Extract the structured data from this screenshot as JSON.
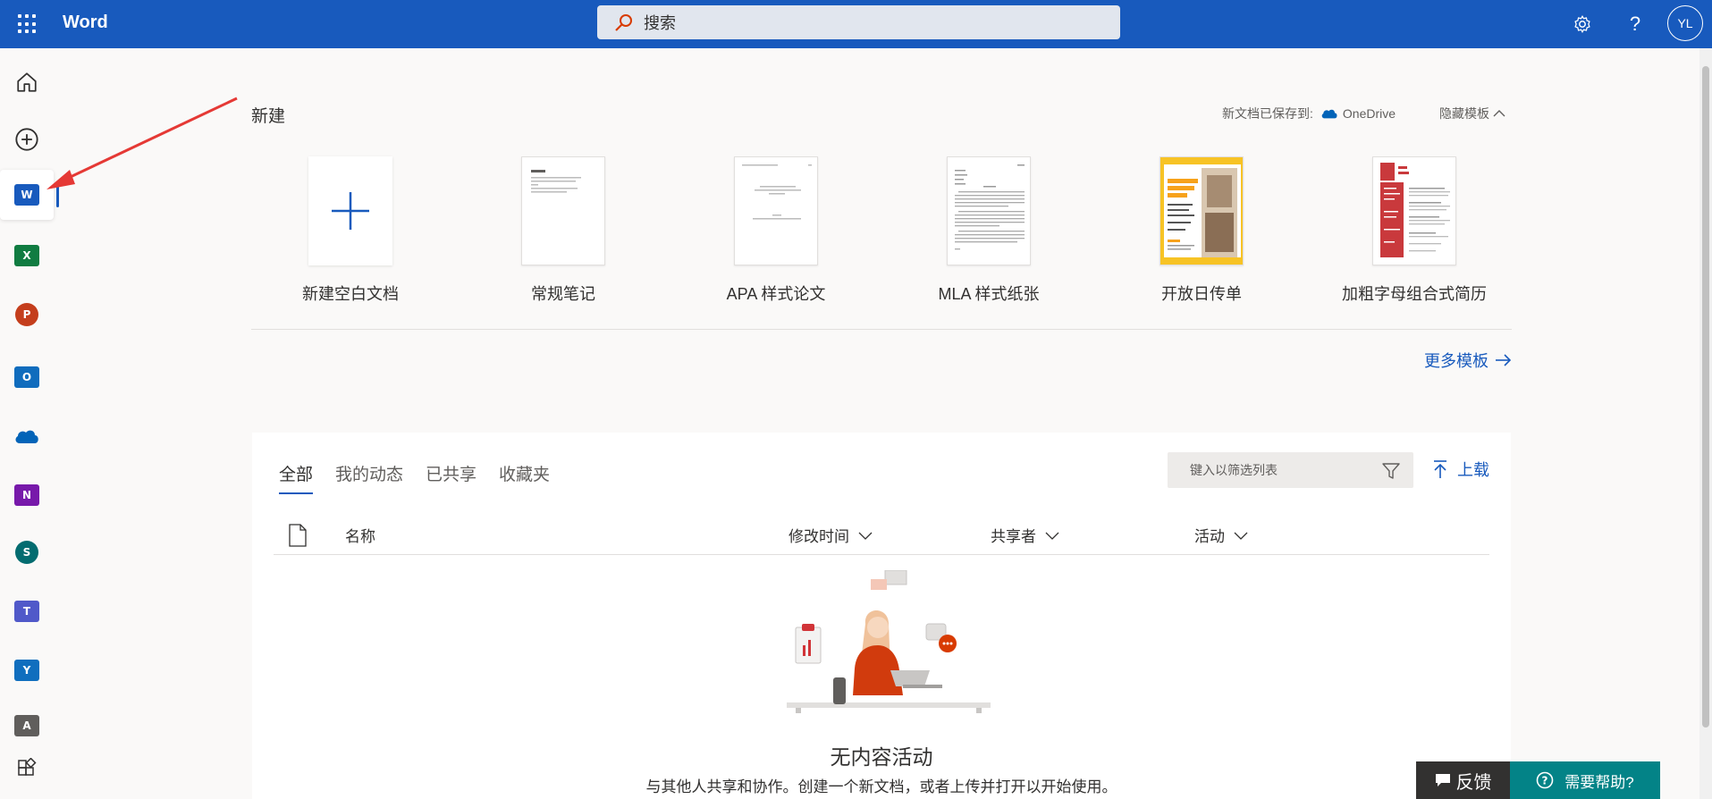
{
  "header": {
    "app_name": "Word",
    "search_label": "搜索",
    "avatar_initials": "YL",
    "icons": [
      "app-launcher-icon",
      "search-icon",
      "settings-icon",
      "help-icon"
    ],
    "brand_color": "#185abd"
  },
  "rail": {
    "items": [
      {
        "name": "home",
        "icon": "home-icon"
      },
      {
        "name": "create",
        "icon": "plus-circle-icon"
      },
      {
        "name": "word",
        "letter": "W",
        "color": "#185abd",
        "active": true
      },
      {
        "name": "excel",
        "letter": "X",
        "color": "#107c41"
      },
      {
        "name": "powerpoint",
        "letter": "P",
        "color": "#c43e1c"
      },
      {
        "name": "outlook",
        "letter": "O",
        "color": "#0f6cbd"
      },
      {
        "name": "onedrive",
        "icon": "cloud-icon",
        "color": "#0364b8"
      },
      {
        "name": "onenote",
        "letter": "N",
        "color": "#7719aa"
      },
      {
        "name": "sharepoint",
        "letter": "S",
        "color": "#036c70"
      },
      {
        "name": "teams",
        "letter": "T",
        "color": "#5059c9"
      },
      {
        "name": "yammer",
        "letter": "Y",
        "color": "#106ebe"
      },
      {
        "name": "admin",
        "letter": "A",
        "color": "#605e5c"
      },
      {
        "name": "all-apps",
        "icon": "all-apps-icon"
      }
    ]
  },
  "new_section": {
    "title": "新建",
    "save_prefix": "新文档已保存到:",
    "save_target": "OneDrive",
    "hide_templates": "隐藏模板",
    "more_templates": "更多模板",
    "templates": [
      {
        "label": "新建空白文档",
        "kind": "blank"
      },
      {
        "label": "常规笔记",
        "kind": "notes"
      },
      {
        "label": "APA 样式论文",
        "kind": "apa"
      },
      {
        "label": "MLA 样式纸张",
        "kind": "mla"
      },
      {
        "label": "开放日传单",
        "kind": "flyer"
      },
      {
        "label": "加粗字母组合式简历",
        "kind": "resume"
      }
    ]
  },
  "files": {
    "tabs": [
      {
        "label": "全部",
        "active": true
      },
      {
        "label": "我的动态"
      },
      {
        "label": "已共享"
      },
      {
        "label": "收藏夹"
      }
    ],
    "filter_placeholder": "键入以筛选列表",
    "upload_label": "上载",
    "columns": {
      "name": "名称",
      "modified": "修改时间",
      "shared_by": "共享者",
      "activity": "活动"
    },
    "empty_title": "无内容活动",
    "empty_subtitle": "与其他人共享和协作。创建一个新文档，或者上传并打开以开始使用。"
  },
  "footer": {
    "feedback": "反馈",
    "help": "需要帮助?"
  }
}
